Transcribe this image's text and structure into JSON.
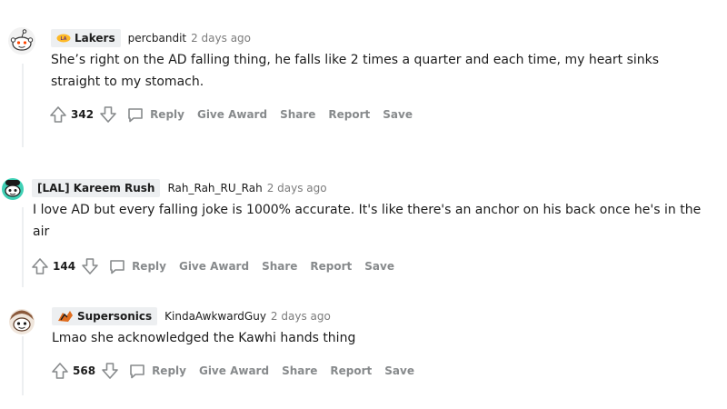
{
  "comments": [
    {
      "flair": "Lakers",
      "flair_icon": "lakers-logo-icon",
      "username": "percbandit",
      "time": "2 days ago",
      "text": "She’s right on the AD falling thing, he falls like 2 times a quarter and each time, my heart sinks straight to my stomach.",
      "score": "342",
      "avatar_color": "#e8e8e8"
    },
    {
      "flair": "[LAL] Kareem Rush",
      "flair_icon": "",
      "username": "Rah_Rah_RU_Rah",
      "time": "2 days ago",
      "text": "I love AD but every falling joke is 1000% accurate. It's like there's an anchor on his back once he's in the air",
      "score": "144",
      "avatar_color": "#3fd0b5"
    },
    {
      "flair": "Supersonics",
      "flair_icon": "supersonics-logo-icon",
      "username": "KindaAwkwardGuy",
      "time": "2 days ago",
      "text": "Lmao she acknowledged the Kawhi hands thing",
      "score": "568",
      "avatar_color": "#8b5a3c"
    }
  ],
  "actions": {
    "reply": "Reply",
    "give_award": "Give Award",
    "share": "Share",
    "report": "Report",
    "save": "Save"
  },
  "icons": {
    "upvote": "upvote-arrow-icon",
    "downvote": "downvote-arrow-icon",
    "reply": "speech-bubble-icon"
  }
}
